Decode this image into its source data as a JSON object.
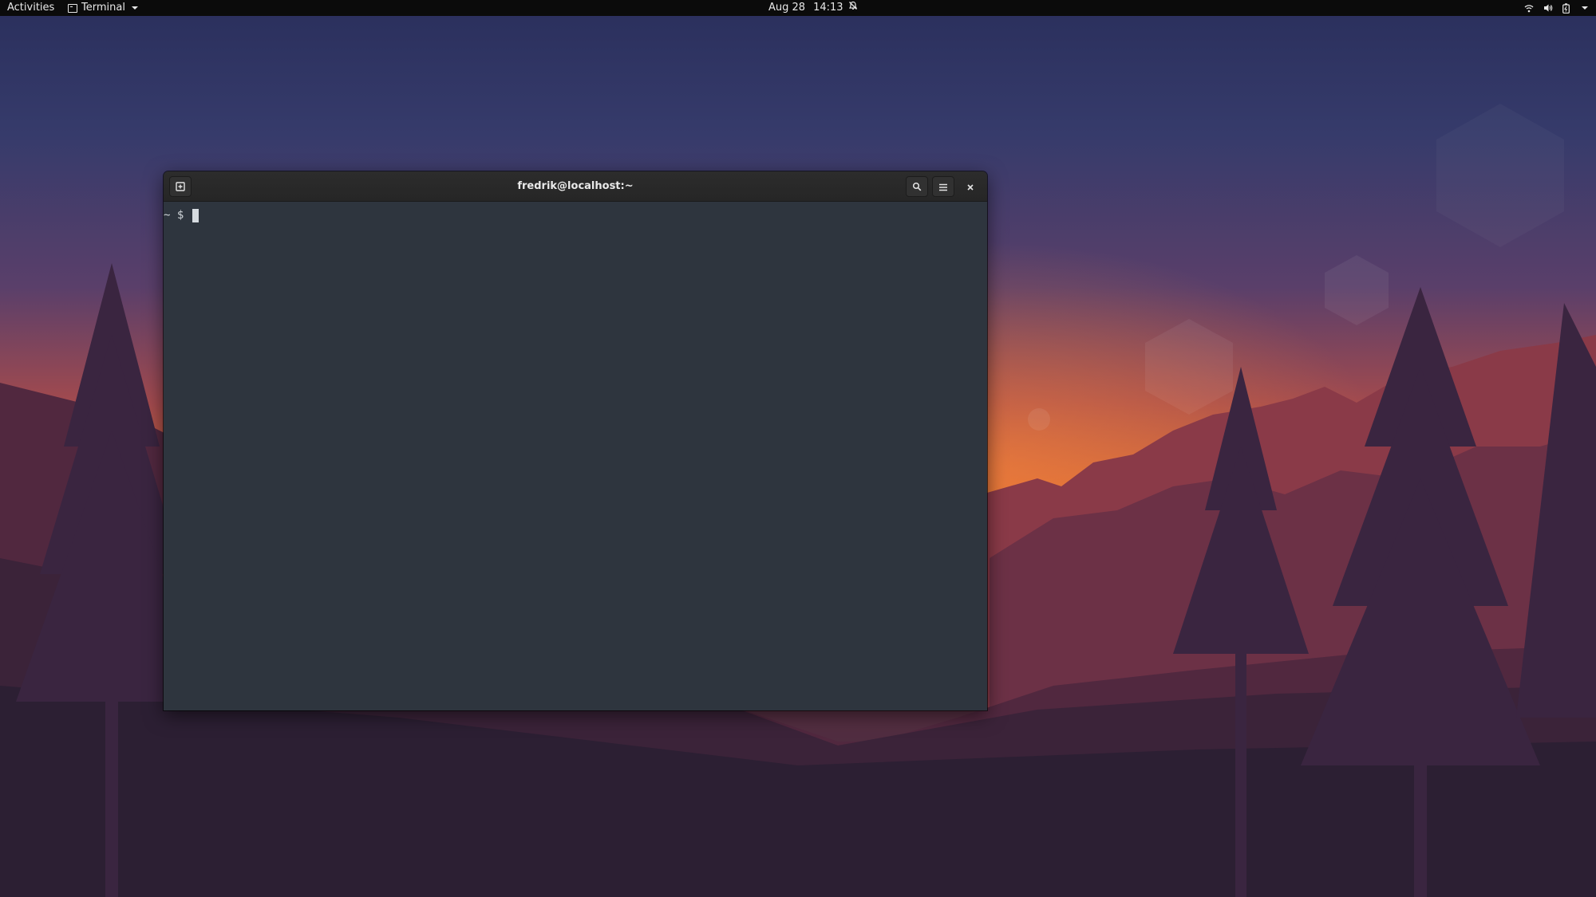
{
  "topbar": {
    "activities_label": "Activities",
    "app_menu_label": "Terminal",
    "clock_date": "Aug 28",
    "clock_time": "14:13",
    "icons": [
      "terminal-icon",
      "notifications-disabled-icon",
      "wifi-icon",
      "volume-icon",
      "battery-icon",
      "system-menu-chevron-icon"
    ]
  },
  "window": {
    "title": "fredrik@localhost:~",
    "buttons": [
      "new-tab-icon",
      "search-icon",
      "hamburger-menu-icon",
      "close-icon"
    ]
  },
  "terminal": {
    "prompt_dir": "~",
    "prompt_symbol": "$"
  },
  "colors": {
    "topbar_bg": "#0b0b0b",
    "terminal_bg": "#2e353e",
    "headerbar_bg": "#282828",
    "text": "#eaeaea"
  }
}
